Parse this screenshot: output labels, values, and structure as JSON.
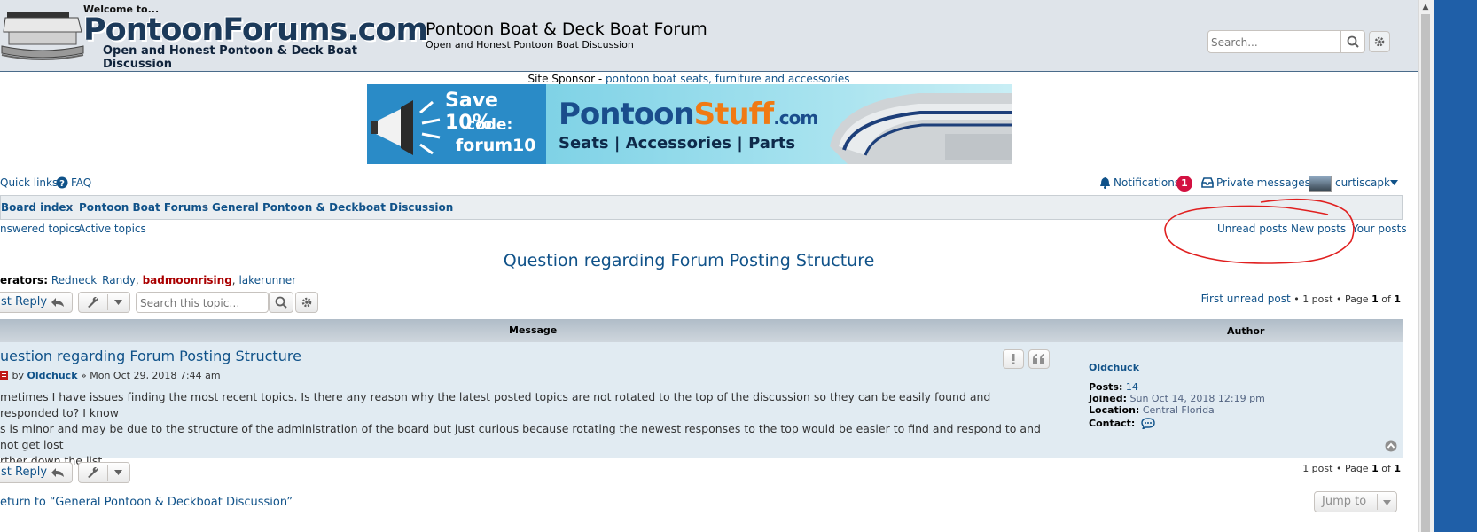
{
  "header": {
    "logo": {
      "welcome": "Welcome to...",
      "main": "PontoonForums.com",
      "tagline": "Open and Honest Pontoon & Deck Boat Discussion"
    },
    "site_title": "Pontoon Boat & Deck Boat Forum",
    "site_description": "Open and Honest Pontoon Boat Discussion",
    "search": {
      "placeholder": "Search..."
    }
  },
  "sponsor": {
    "label": "Site Sponsor",
    "separator": " - ",
    "link_text": "pontoon boat seats, furniture and accessories",
    "banner": {
      "save": "Save 10%",
      "code": "code:",
      "code_value": "forum10",
      "brand_a": "Pontoon",
      "brand_b": "Stuff",
      "brand_c": ".com",
      "tagline": "Seats | Accessories | Parts"
    }
  },
  "navbar": {
    "quick_links": "Quick links",
    "faq": "FAQ",
    "notifications": "Notifications",
    "notification_count": "1",
    "private_messages": "Private messages",
    "username": "curtiscapk"
  },
  "breadcrumbs": [
    "Board index",
    "Pontoon Boat Forums",
    "General Pontoon & Deckboat Discussion"
  ],
  "sub_links": {
    "left": [
      "nswered topics",
      "Active topics"
    ],
    "right": [
      "Unread posts",
      "New posts",
      "Your posts"
    ]
  },
  "topic": {
    "title": "Question regarding Forum Posting Structure",
    "moderators_label": "erators:",
    "moderators": [
      "Redneck_Randy",
      "badmoonrising",
      "lakerunner"
    ],
    "moderator_colors": [
      "#105289",
      "#aa0000",
      "#105289"
    ],
    "reply_label": "st Reply",
    "search_placeholder": "Search this topic…",
    "pagination_top": {
      "first_unread": "First unread post",
      "sep": " • ",
      "count": "1 post",
      "page_word": "Page",
      "page": "1",
      "of": "of",
      "total": "1"
    },
    "pagination_bottom": {
      "count": "1 post",
      "sep": " • ",
      "page_word": "Page",
      "page": "1",
      "of": "of",
      "total": "1"
    }
  },
  "table": {
    "col_message": "Message",
    "col_author": "Author"
  },
  "post": {
    "title": "uestion regarding Forum Posting Structure",
    "by": "by",
    "author": "Oldchuck",
    "date": "» Mon Oct 29, 2018 7:44 am",
    "body_lines": [
      "metimes I have issues finding the most recent topics. Is there any reason why the latest posted topics are not rotated to the top of the discussion so they can be easily found and responded to? I know",
      "s is minor and may be due to the structure of the administration of the board but just curious because rotating the newest responses to the top would be easier to find and respond to and not get lost",
      "rther down the list.."
    ]
  },
  "author_panel": {
    "name": "Oldchuck",
    "posts_label": "Posts:",
    "posts_value": "14",
    "joined_label": "Joined:",
    "joined_value": "Sun Oct 14, 2018 12:19 pm",
    "location_label": "Location:",
    "location_value": "Central Florida",
    "contact_label": "Contact:"
  },
  "footer": {
    "return_text": "eturn to “General Pontoon & Deckboat Discussion”",
    "jump_to": "Jump to"
  },
  "colors": {
    "link": "#105289",
    "accent_red": "#d31141",
    "annotation": "#e02020"
  }
}
